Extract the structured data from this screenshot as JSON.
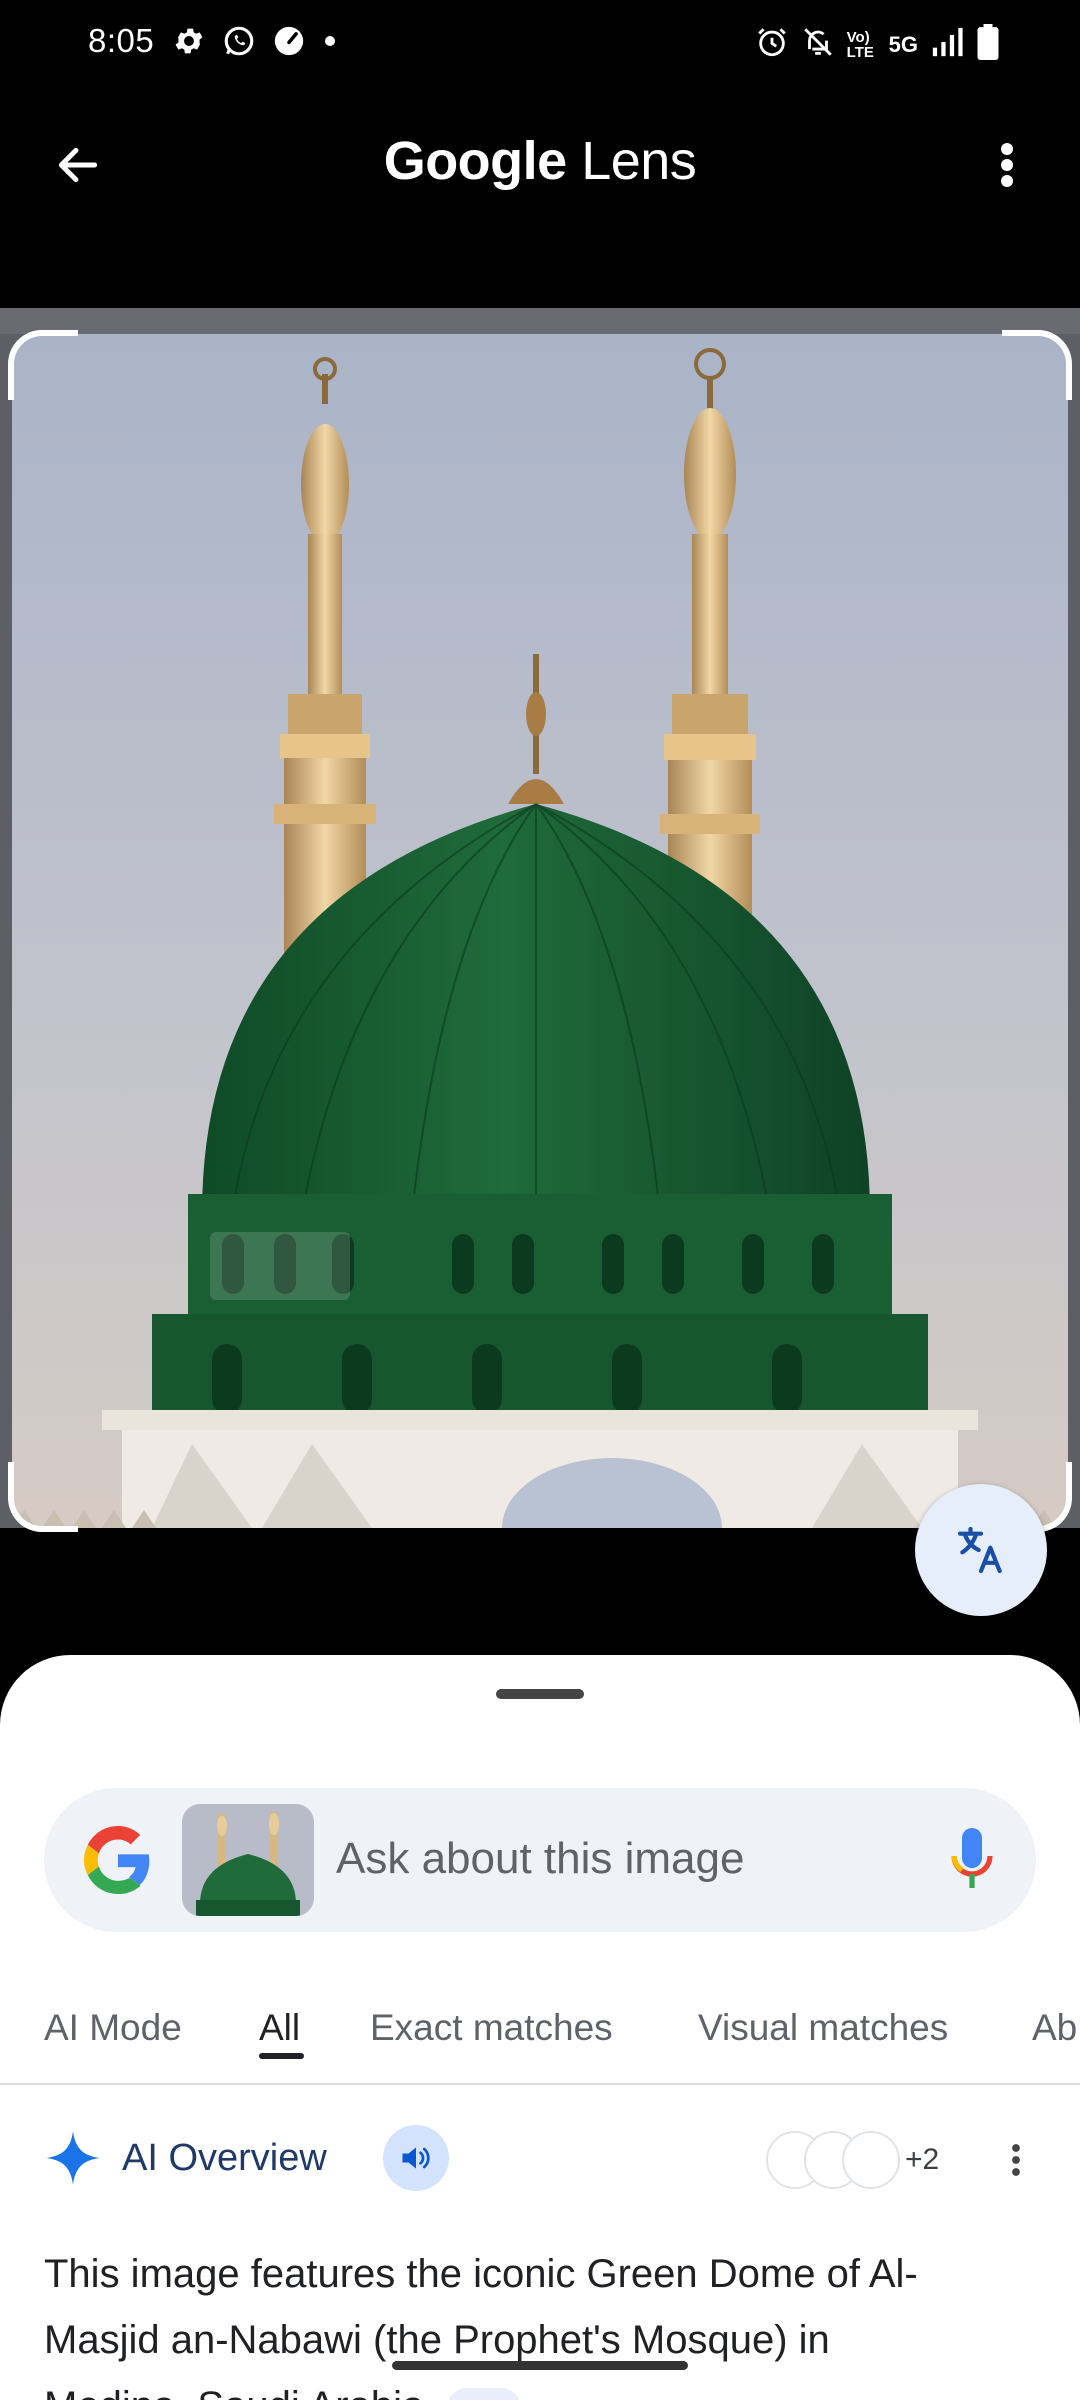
{
  "status_bar": {
    "time": "8:05",
    "network": "5G",
    "volte": "Vo) LTE"
  },
  "app_bar": {
    "title_part1": "Google",
    "title_part2": " Lens"
  },
  "search": {
    "placeholder": "Ask about this image"
  },
  "tabs": [
    {
      "label": "AI Mode",
      "active": false
    },
    {
      "label": "All",
      "active": true
    },
    {
      "label": "Exact matches",
      "active": false
    },
    {
      "label": "Visual matches",
      "active": false
    },
    {
      "label": "Ab",
      "active": false
    }
  ],
  "ai_overview": {
    "title": "AI Overview",
    "source_count": "+2",
    "body_line1": "This image features the iconic Green Dome of Al-",
    "body_line2": "Masjid an-Nabawi (the Prophet's Mosque) in",
    "body_line3": "Medina, Saudi Arabia."
  },
  "colors": {
    "accent_blue": "#1a73e8",
    "dome_green": "#1f6b3a",
    "sheet_bg": "#ffffff"
  },
  "icons": [
    "settings-icon",
    "whatsapp-icon",
    "speedometer-icon",
    "alarm-icon",
    "mute-icon",
    "signal-icon",
    "battery-icon",
    "back-arrow-icon",
    "more-vert-icon",
    "translate-icon",
    "google-g-icon",
    "mic-icon",
    "sparkle-icon",
    "speaker-icon"
  ]
}
